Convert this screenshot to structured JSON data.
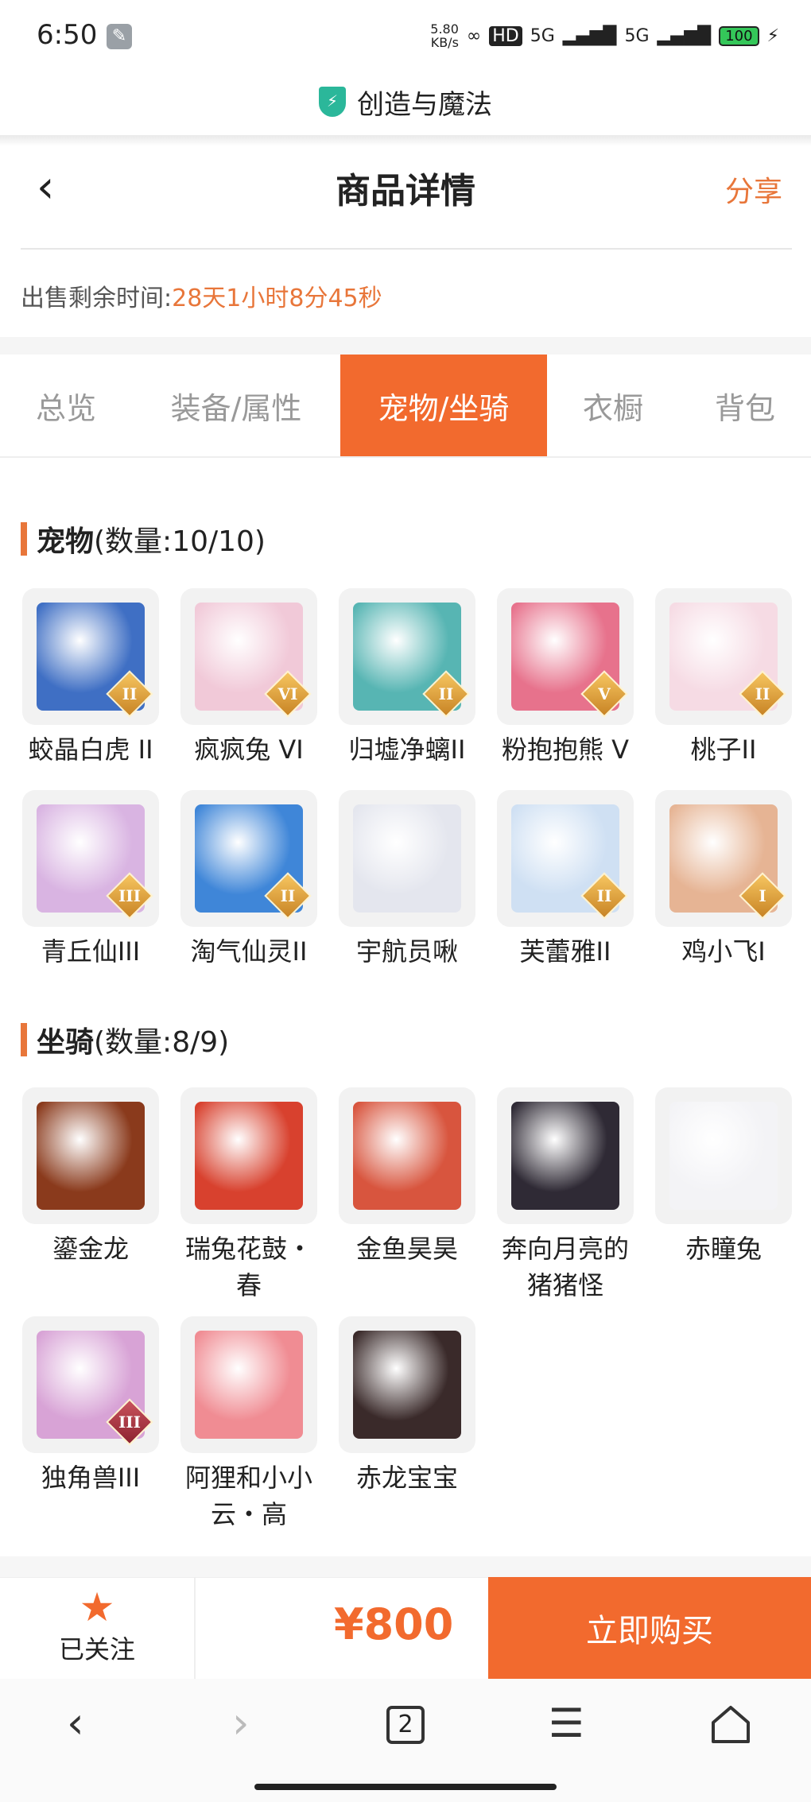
{
  "status_bar": {
    "time": "6:50",
    "net_speed": "5.80",
    "net_unit": "KB/s",
    "hd": "HD",
    "signal1": "5G",
    "signal2": "5G",
    "battery": "100"
  },
  "browser": {
    "site_name": "创造与魔法",
    "tab_count": "2"
  },
  "header": {
    "title": "商品详情",
    "share_label": "分享"
  },
  "sale": {
    "label": "出售剩余时间:",
    "countdown": "28天1小时8分45秒"
  },
  "tabs": [
    {
      "label": "总览",
      "active": false
    },
    {
      "label": "装备/属性",
      "active": false
    },
    {
      "label": "宠物/坐骑",
      "active": true
    },
    {
      "label": "衣橱",
      "active": false
    },
    {
      "label": "背包",
      "active": false
    }
  ],
  "pets": {
    "title": "宠物",
    "count": "(数量:10/10)",
    "items": [
      {
        "name": "蛟晶白虎 II",
        "badge": "II",
        "color": "#3f6fc4"
      },
      {
        "name": "疯疯兔 VI",
        "badge": "VI",
        "color": "#f1c9d8"
      },
      {
        "name": "归墟净螭II",
        "badge": "II",
        "color": "#57b5b3"
      },
      {
        "name": "粉抱抱熊 V",
        "badge": "V",
        "color": "#e7728c"
      },
      {
        "name": "桃子II",
        "badge": "II",
        "color": "#f6dbe4"
      },
      {
        "name": "青丘仙III",
        "badge": "III",
        "color": "#d9b4e2"
      },
      {
        "name": "淘气仙灵II",
        "badge": "II",
        "color": "#3f86d8"
      },
      {
        "name": "宇航员啾",
        "badge": "",
        "color": "#e4e6ee"
      },
      {
        "name": "芙蕾雅II",
        "badge": "II",
        "color": "#cfe0f3"
      },
      {
        "name": "鸡小飞I",
        "badge": "I",
        "color": "#e6b494"
      }
    ]
  },
  "mounts": {
    "title": "坐骑",
    "count": "(数量:8/9)",
    "items": [
      {
        "name": "鎏金龙",
        "badge": "",
        "color": "#8a3a1c"
      },
      {
        "name": "瑞兔花鼓・春",
        "badge": "",
        "color": "#d8412e"
      },
      {
        "name": "金鱼昊昊",
        "badge": "",
        "color": "#d8553e"
      },
      {
        "name": "奔向月亮的猪猪怪",
        "badge": "",
        "color": "#2f2a35"
      },
      {
        "name": "赤瞳兔",
        "badge": "",
        "color": "#f3f3f6"
      },
      {
        "name": "独角兽III",
        "badge": "III",
        "color": "#d8a3d6"
      },
      {
        "name": "阿狸和小小云・高",
        "badge": "",
        "color": "#f08c93"
      },
      {
        "name": "赤龙宝宝",
        "badge": "",
        "color": "#3a2a2a"
      }
    ]
  },
  "footer": {
    "follow_label": "已关注",
    "price": "¥800",
    "buy_label": "立即购买"
  },
  "colors": {
    "accent": "#f26a2e",
    "countdown": "#e8763a"
  },
  "icons": {
    "back": "chevron-left-icon",
    "follow": "star-icon",
    "site": "shield-icon"
  }
}
